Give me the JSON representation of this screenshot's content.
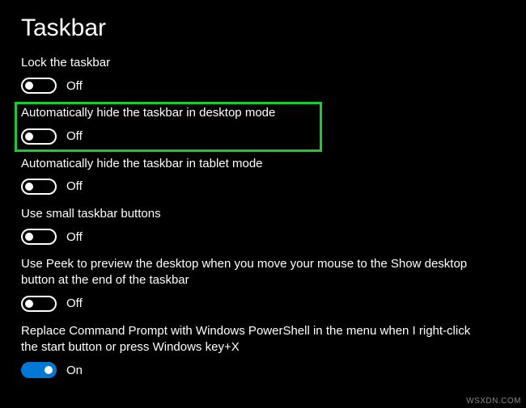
{
  "title": "Taskbar",
  "settings": [
    {
      "label": "Lock the taskbar",
      "state": "Off",
      "on": false,
      "highlighted": false
    },
    {
      "label": "Automatically hide the taskbar in desktop mode",
      "state": "Off",
      "on": false,
      "highlighted": true
    },
    {
      "label": "Automatically hide the taskbar in tablet mode",
      "state": "Off",
      "on": false,
      "highlighted": false
    },
    {
      "label": "Use small taskbar buttons",
      "state": "Off",
      "on": false,
      "highlighted": false
    },
    {
      "label": "Use Peek to preview the desktop when you move your mouse to the Show desktop button at the end of the taskbar",
      "state": "Off",
      "on": false,
      "highlighted": false
    },
    {
      "label": "Replace Command Prompt with Windows PowerShell in the menu when I right-click the start button or press Windows key+X",
      "state": "On",
      "on": true,
      "highlighted": false
    }
  ],
  "watermark": "WSXDN.COM"
}
